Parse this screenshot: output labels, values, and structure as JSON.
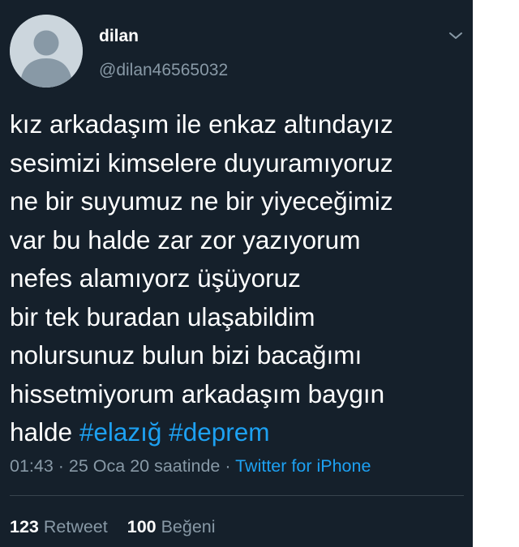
{
  "colors": {
    "background": "#15202b",
    "text": "#ffffff",
    "secondary_text": "#8899a6",
    "accent": "#1da1f2",
    "divider": "#38444d"
  },
  "header": {
    "display_name": "dilan",
    "handle": "@dilan46565032",
    "avatar_icon": "default-avatar-icon",
    "menu_icon": "chevron-down-icon"
  },
  "body": {
    "lines": [
      "kız arkadaşım ile enkaz altındayız",
      "sesimizi kimselere duyuramıyoruz",
      "ne bir suyumuz ne bir yiyeceğimiz",
      "var bu halde zar zor yazıyorum",
      "nefes alamıyorz üşüyoruz",
      "bir tek buradan ulaşabildim",
      "nolursunuz bulun bizi bacağımı",
      "hissetmiyorum arkadaşım baygın"
    ],
    "last_line_text": "halde ",
    "hashtags": [
      "#elazığ",
      "#deprem"
    ]
  },
  "meta": {
    "time": "01:43",
    "separator": " · ",
    "date": "25 Oca 20 saatinde",
    "source": "Twitter for iPhone"
  },
  "stats": {
    "retweets_count": "123",
    "retweets_label": "Retweet",
    "likes_count": "100",
    "likes_label": "Beğeni"
  }
}
